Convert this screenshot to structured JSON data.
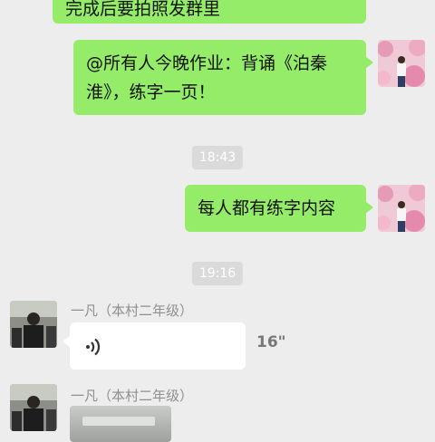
{
  "messages": {
    "m0_partial": "完成后要拍照发群里",
    "m1_homework": "@所有人今晚作业：背诵《泊秦淮》，练字一页！",
    "m1_line1": "@所有人今晚作业：背诵《泊秦",
    "m1_line2": "淮》，练字一页！",
    "m2_practice": "每人都有练字内容"
  },
  "timestamps": {
    "t1": "18:43",
    "t2": "19:16"
  },
  "incoming": {
    "sender_name": "一凡（本村二年级）",
    "voice_duration": "16\""
  },
  "icons": {
    "voice": "voice-wave-icon"
  },
  "colors": {
    "outgoing_bubble": "#95ec69",
    "background": "#ededed",
    "incoming_bubble": "#ffffff"
  }
}
